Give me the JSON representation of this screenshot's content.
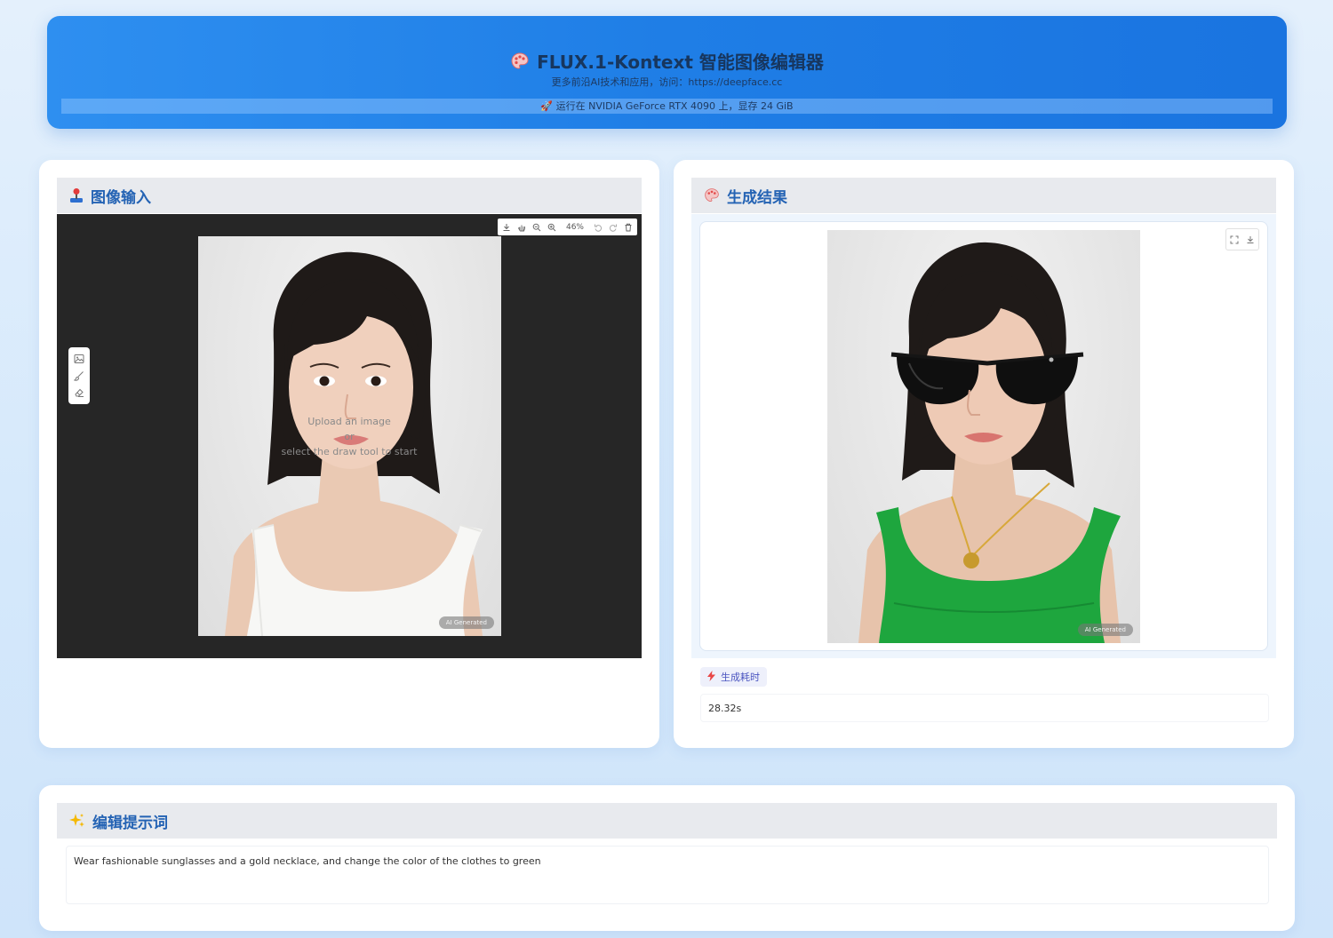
{
  "header": {
    "title": "FLUX.1-Kontext 智能图像编辑器",
    "subtitle": "更多前沿AI技术和应用，访问：https://deepface.cc",
    "gpu_info": "运行在 NVIDIA GeForce RTX 4090 上，显存 24 GiB"
  },
  "input_panel": {
    "title": "图像输入",
    "zoom": "46%",
    "placeholder_line1": "Upload an image",
    "placeholder_line2": "or",
    "placeholder_line3": "select the draw tool to start",
    "badge": "AI Generated",
    "toolbar_icons": [
      "download-icon",
      "pan-icon",
      "zoom-out-icon",
      "zoom-in-icon",
      "undo-icon",
      "redo-icon",
      "trash-icon"
    ],
    "side_tools": [
      "image-icon",
      "brush-icon",
      "eraser-icon"
    ]
  },
  "output_panel": {
    "title": "生成结果",
    "badge": "AI Generated",
    "time_label": "生成耗时",
    "time_value": "28.32s"
  },
  "prompt_panel": {
    "title": "编辑提示词",
    "text": "Wear fashionable sunglasses and a gold necklace, and change the color of the clothes to green"
  },
  "colors": {
    "header_bg": "#1f7ee6",
    "accent_title": "#2463b4",
    "dress_output": "#1ea63e"
  }
}
